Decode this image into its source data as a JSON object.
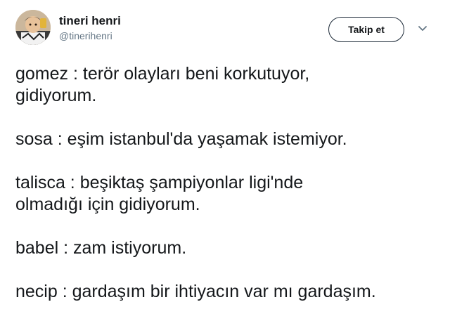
{
  "user": {
    "name": "tineri henri",
    "handle": "@tinerihenri",
    "avatar_icon": "profile-photo"
  },
  "follow_button": {
    "label": "Takip et"
  },
  "menu": {
    "icon": "chevron-down-icon"
  },
  "tweet": {
    "lines": [
      "gomez : terör olayları beni korkutuyor,",
      "gidiyorum.",
      "sosa : eşim istanbul'da yaşamak istemiyor.",
      "talisca : beşiktaş şampiyonlar ligi'nde",
      "olmadığı için gidiyorum.",
      "babel : zam istiyorum.",
      "necip : gardaşım bir ihtiyacın var mı gardaşım."
    ]
  },
  "colors": {
    "text": "#14171a",
    "secondary": "#657786",
    "button_border": "#1b2836"
  }
}
